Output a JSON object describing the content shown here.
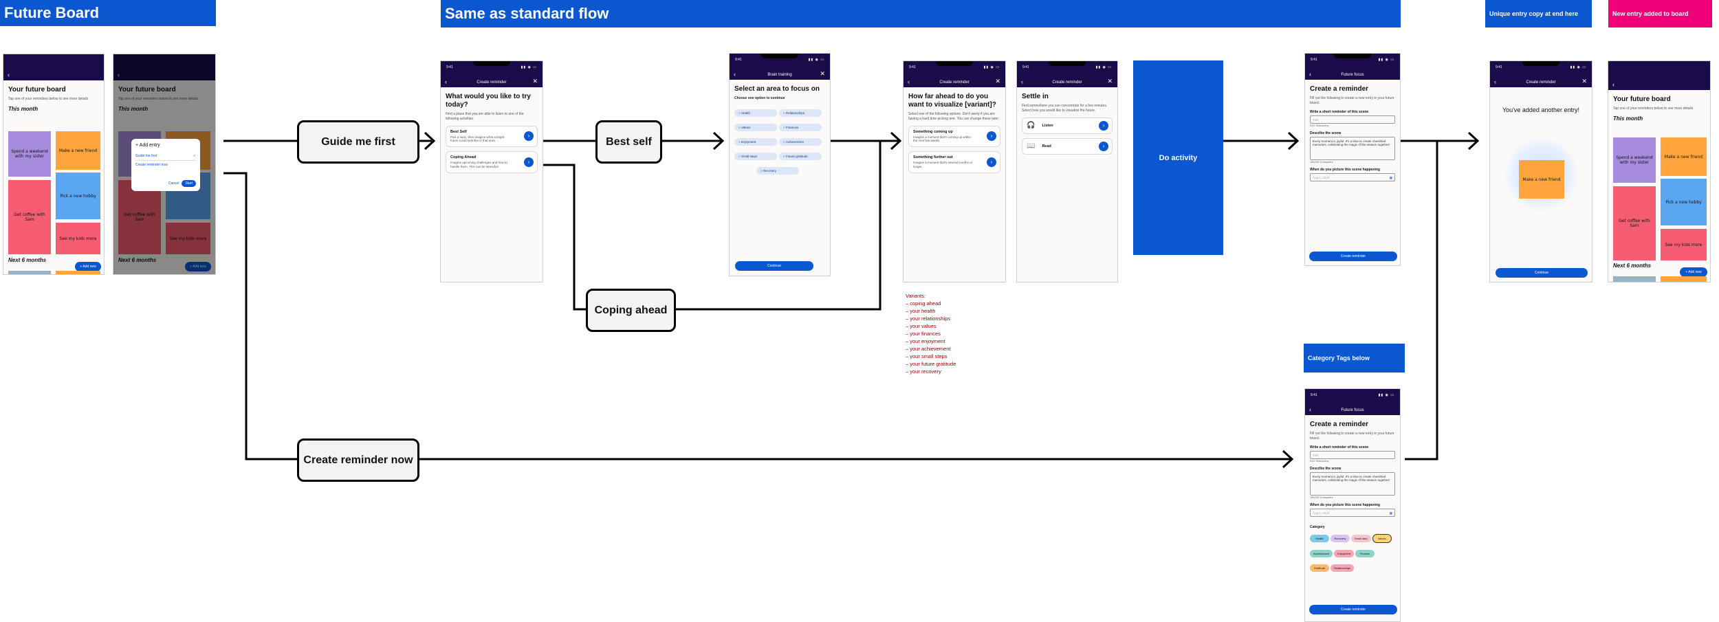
{
  "headers": {
    "future_board": "Future Board",
    "standard_flow": "Same as standard flow",
    "unique_copy": "Unique entry copy at end here",
    "new_entry": "New entry added to board",
    "category_tags": "Category Tags below",
    "do_activity": "Do activity"
  },
  "nodes": {
    "guide": "Guide me first",
    "best_self": "Best self",
    "coping": "Coping ahead",
    "create_now": "Create reminder now"
  },
  "board": {
    "title": "Your future board",
    "subtitle": "Tap one of your reminders below to see more details",
    "this_month": "This month",
    "next6": "Next 6 months",
    "add_new": "+ Add new",
    "notes": [
      "Spend a weekend with my sister",
      "Make a new friend",
      "Get coffee with Sam",
      "Pick a new hobby",
      "See my kids more"
    ]
  },
  "modal": {
    "title": "+ Add entry",
    "opt1": "Guide me first",
    "opt2": "Create reminder now",
    "cancel": "Cancel",
    "start": "Start"
  },
  "screen_try": {
    "time": "9:41",
    "header": "Create reminder",
    "title": "What would you like to try today?",
    "sub": "Find a place that you are able to listen to one of the following activities.",
    "c1_title": "Best Self",
    "c1_text": "Pick a topic, then imagine what a bright future could look like in that area.",
    "c2_title": "Coping Ahead",
    "c2_text": "Imagine upcoming challenges and how to handle them. This can be stressful!"
  },
  "screen_area": {
    "time": "9:41",
    "header": "Brain training",
    "title": "Select an area to focus on",
    "sub": "Choose one option to continue",
    "pills": [
      "Health",
      "Relationships",
      "Values",
      "Finances",
      "Enjoyment",
      "Achievement",
      "Small steps",
      "Future gratitude",
      "Recovery"
    ],
    "continue": "Continue"
  },
  "screen_far": {
    "time": "9:41",
    "header": "Create reminder",
    "title": "How far ahead to do you want to visualize [variant]?",
    "sub": "Select one of the following options. Don't worry if you are having a hard time picking one. You can change these later.",
    "c1_title": "Something coming up",
    "c1_text": "Imagine a moment that's coming up within the next few weeks.",
    "c2_title": "Something further out",
    "c2_text": "Imagine a moment that's several months or longer."
  },
  "screen_settle": {
    "time": "9:41",
    "header": "Create reminder",
    "title": "Settle in",
    "sub": "Find somewhere you can concentrate for a few minutes. Select how you would like to visualize the future.",
    "opt1": "Listen",
    "opt2": "Read"
  },
  "variants": {
    "heading": "Variants:",
    "items": [
      "coping ahead",
      "your health",
      "your relationships",
      "your values",
      "your finances",
      "your enjoyment",
      "your achievement",
      "your small steps",
      "your future gratitude",
      "your recovery"
    ]
  },
  "screen_create": {
    "time": "9:41",
    "header": "Future focus",
    "title": "Create a reminder",
    "sub": "Fill out the following to create a new entry in your future board.",
    "l1": "Write a short reminder of this scene",
    "p1": "Title",
    "c1": "0/40 Characters",
    "l2": "Describe the scene",
    "t2": "Every moment is joyful. It's a time to create cherished memories, celebrating the magic of the season together!",
    "c2": "150/250 Characters",
    "l3": "When do you picture this scene happening",
    "p3": "Aug 5, 2024",
    "btn": "Create reminder"
  },
  "screen_create2": {
    "time": "9:41",
    "header": "Future focus",
    "title": "Create a reminder",
    "sub": "Fill out the following to create a new entry in your future board.",
    "l1": "Write a short reminder of this scene",
    "p1": "Title",
    "c1": "0/40 Characters",
    "l2": "Describe the scene",
    "t2": "Every moment is joyful. It's a time to create cherished memories, celebrating the magic of the season together!",
    "c2": "150/250 Characters",
    "l3": "When do you picture this scene happening",
    "p3": "Aug 5, 2024",
    "cat": "Category",
    "tags": [
      "Health",
      "Recovery",
      "Small step",
      "Values",
      "Achievement",
      "Enjoyment",
      "Finance",
      "Gratitude",
      "Relationships"
    ],
    "btn": "Create reminder"
  },
  "screen_added": {
    "time": "9:41",
    "header": "Create reminder",
    "title": "You've added another entry!",
    "note": "Make a new friend",
    "btn": "Continue"
  },
  "colors": {
    "blue": "#0b57d0",
    "pink": "#f2007a",
    "dark_header": "#1b0b4a",
    "variant_red": "#8b0000"
  }
}
